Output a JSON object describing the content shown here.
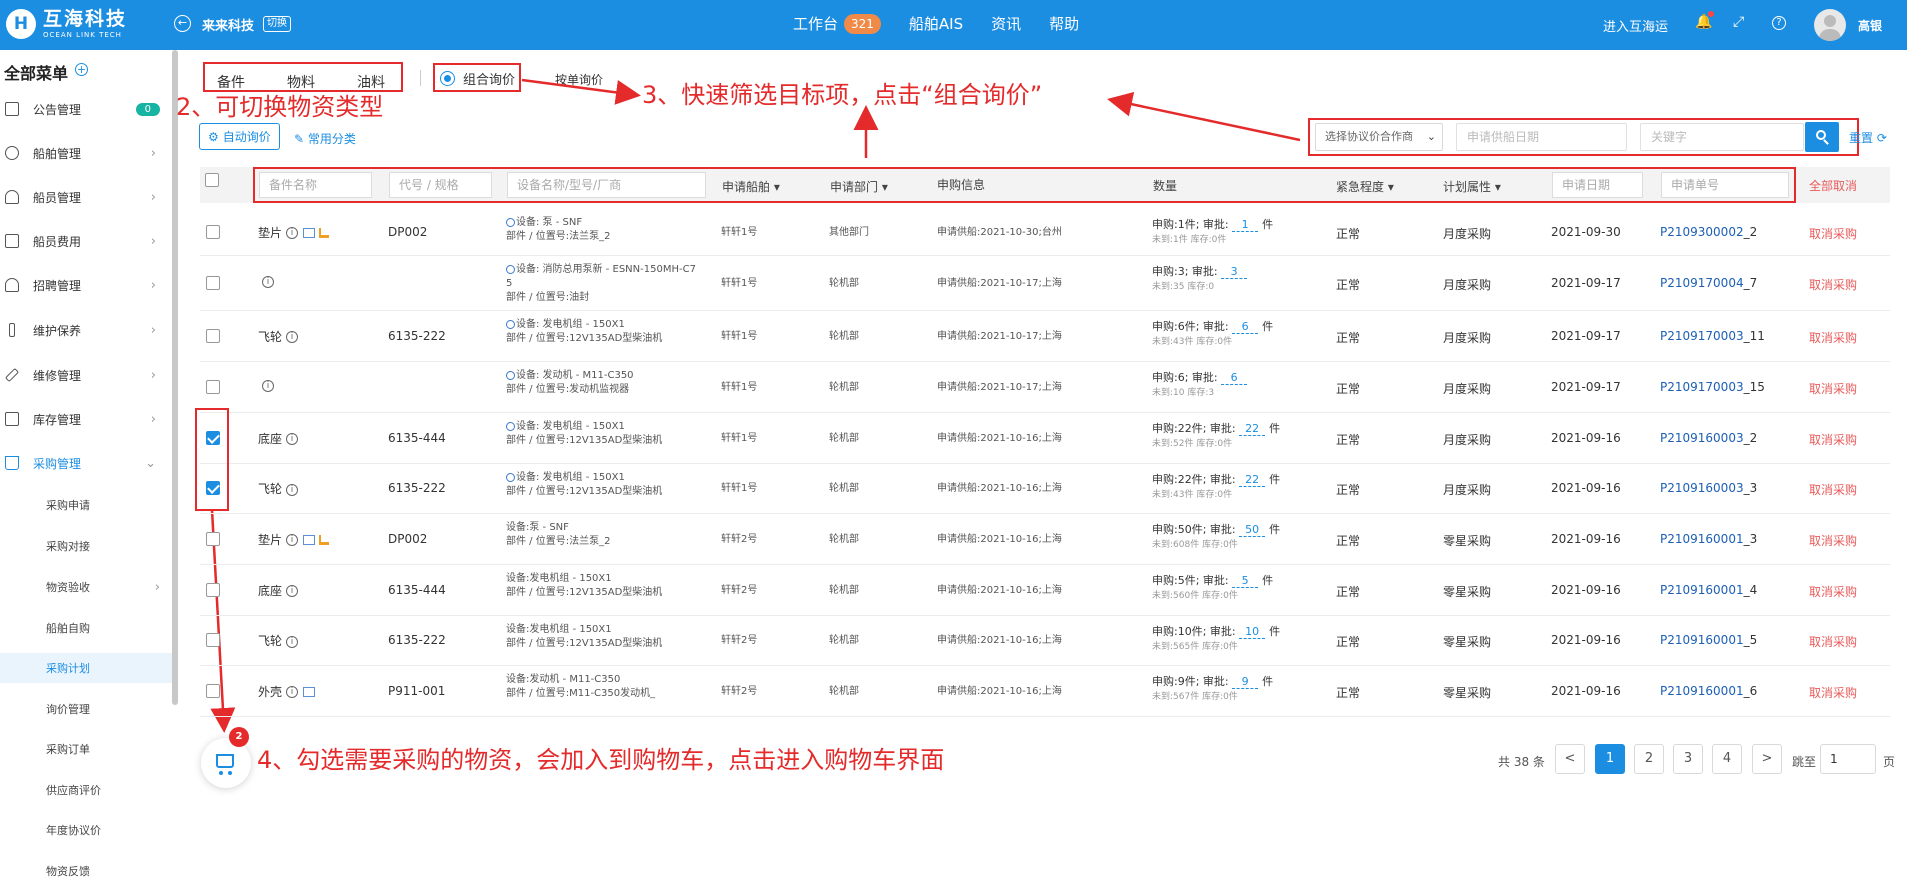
{
  "header": {
    "logo_mark": "H",
    "brand_name": "互海科技",
    "brand_en": "OCEAN LINK TECH",
    "company": "来来科技",
    "switch_label": "切换",
    "nav": [
      {
        "label": "工作台",
        "badge": "321"
      },
      {
        "label": "船舶AIS"
      },
      {
        "label": "资讯"
      },
      {
        "label": "帮助"
      }
    ],
    "enter_link": "进入互海运",
    "username": "高银"
  },
  "sidebar": {
    "title": "全部菜单",
    "items": [
      {
        "label": "公告管理",
        "badge": "0"
      },
      {
        "label": "船舶管理"
      },
      {
        "label": "船员管理"
      },
      {
        "label": "船员费用"
      },
      {
        "label": "招聘管理"
      },
      {
        "label": "维护保养"
      },
      {
        "label": "维修管理"
      },
      {
        "label": "库存管理"
      },
      {
        "label": "采购管理"
      }
    ],
    "sub_items": [
      "采购申请",
      "采购对接",
      "物资验收",
      "船舶自购",
      "采购计划",
      "询价管理",
      "采购订单",
      "供应商评价",
      "年度协议价",
      "物资反馈"
    ]
  },
  "toolbar": {
    "type_tabs": [
      "备件",
      "物料",
      "油料"
    ],
    "combo_inquiry": "组合询价",
    "by_order": "按单询价",
    "auto_inquiry": "自动询价",
    "common_category": "常用分类",
    "partner_select": "选择协议价合作商",
    "date_placeholder": "申请供船日期",
    "keyword_placeholder": "关键字",
    "reset": "重置"
  },
  "annotations": {
    "a2": "2、可切换物资类型",
    "a3": "3、快速筛选目标项，点击“组合询价”",
    "a4": "4、勾选需要采购的物资，会加入到购物车，点击进入购物车界面"
  },
  "table": {
    "filters": {
      "part_name": "备件名称",
      "code_spec": "代号 / 规格",
      "device": "设备名称/型号/厂商",
      "apply_date": "申请日期",
      "order_no": "申请单号"
    },
    "headers": {
      "ship": "申请船舶",
      "dept": "申请部门",
      "apply_info": "申购信息",
      "qty": "数量",
      "urgency": "紧急程度",
      "plan": "计划属性",
      "cancel_all": "全部取消"
    },
    "rows": [
      {
        "name": "垫片",
        "img": true,
        "stack": true,
        "code": "DP002",
        "dev1": "设备: 泵 - SNF",
        "dev2": "部件 / 位置号:法兰泵_2",
        "chain": true,
        "ship": "轩轩1号",
        "dept": "其他部门",
        "info": "申请供船:2021-10-30;台州",
        "qty1": "申购:1件; 审批:",
        "approve": "1",
        "unit": "件",
        "qty2": "未到:1件 库存:0件",
        "urgency": "正常",
        "plan": "月度采购",
        "date": "2021-09-30",
        "order": "P2109300002",
        "suffix": "_2",
        "cancel": "取消采购",
        "checked": false
      },
      {
        "name": "",
        "img": false,
        "stack": false,
        "code": "",
        "dev1": "设备: 消防总用泵新 - ESNN-150MH-C7",
        "dev1b": "5",
        "dev2": "部件 / 位置号:油封",
        "chain": true,
        "ship": "轩轩1号",
        "dept": "轮机部",
        "info": "申请供船:2021-10-17;上海",
        "qty1": "申购:3; 审批:",
        "approve": "3",
        "unit": "",
        "qty2": "未到:35 库存:0",
        "urgency": "正常",
        "plan": "月度采购",
        "date": "2021-09-17",
        "order": "P2109170004",
        "suffix": "_7",
        "cancel": "取消采购",
        "checked": false
      },
      {
        "name": "飞轮",
        "img": false,
        "stack": false,
        "code": "6135-222",
        "dev1": "设备: 发电机组 - 150X1",
        "dev2": "部件 / 位置号:12V135AD型柴油机",
        "chain": true,
        "ship": "轩轩1号",
        "dept": "轮机部",
        "info": "申请供船:2021-10-17;上海",
        "qty1": "申购:6件; 审批:",
        "approve": "6",
        "unit": "件",
        "qty2": "未到:43件 库存:0件",
        "urgency": "正常",
        "plan": "月度采购",
        "date": "2021-09-17",
        "order": "P2109170003",
        "suffix": "_11",
        "cancel": "取消采购",
        "checked": false
      },
      {
        "name": "",
        "img": false,
        "stack": false,
        "code": "",
        "dev1": "设备: 发动机 - M11-C350",
        "dev2": "部件 / 位置号:发动机监视器",
        "chain": true,
        "ship": "轩轩1号",
        "dept": "轮机部",
        "info": "申请供船:2021-10-17;上海",
        "qty1": "申购:6; 审批:",
        "approve": "6",
        "unit": "",
        "qty2": "未到:10 库存:3",
        "urgency": "正常",
        "plan": "月度采购",
        "date": "2021-09-17",
        "order": "P2109170003",
        "suffix": "_15",
        "cancel": "取消采购",
        "checked": false
      },
      {
        "name": "底座",
        "img": false,
        "stack": false,
        "code": "6135-444",
        "dev1": "设备: 发电机组 - 150X1",
        "dev2": "部件 / 位置号:12V135AD型柴油机",
        "chain": true,
        "ship": "轩轩1号",
        "dept": "轮机部",
        "info": "申请供船:2021-10-16;上海",
        "qty1": "申购:22件; 审批:",
        "approve": "22",
        "unit": "件",
        "qty2": "未到:52件 库存:0件",
        "urgency": "正常",
        "plan": "月度采购",
        "date": "2021-09-16",
        "order": "P2109160003",
        "suffix": "_2",
        "cancel": "取消采购",
        "checked": true
      },
      {
        "name": "飞轮",
        "img": false,
        "stack": false,
        "code": "6135-222",
        "dev1": "设备: 发电机组 - 150X1",
        "dev2": "部件 / 位置号:12V135AD型柴油机",
        "chain": true,
        "ship": "轩轩1号",
        "dept": "轮机部",
        "info": "申请供船:2021-10-16;上海",
        "qty1": "申购:22件; 审批:",
        "approve": "22",
        "unit": "件",
        "qty2": "未到:43件 库存:0件",
        "urgency": "正常",
        "plan": "月度采购",
        "date": "2021-09-16",
        "order": "P2109160003",
        "suffix": "_3",
        "cancel": "取消采购",
        "checked": true
      },
      {
        "name": "垫片",
        "img": true,
        "stack": true,
        "code": "DP002",
        "dev1": "设备:泵 - SNF",
        "dev2": "部件 / 位置号:法兰泵_2",
        "chain": false,
        "ship": "轩轩2号",
        "dept": "轮机部",
        "info": "申请供船:2021-10-16;上海",
        "qty1": "申购:50件; 审批:",
        "approve": "50",
        "unit": "件",
        "qty2": "未到:608件 库存:0件",
        "urgency": "正常",
        "plan": "零星采购",
        "date": "2021-09-16",
        "order": "P2109160001",
        "suffix": "_3",
        "cancel": "取消采购",
        "checked": false
      },
      {
        "name": "底座",
        "img": false,
        "stack": false,
        "code": "6135-444",
        "dev1": "设备:发电机组 - 150X1",
        "dev2": "部件 / 位置号:12V135AD型柴油机",
        "chain": false,
        "ship": "轩轩2号",
        "dept": "轮机部",
        "info": "申请供船:2021-10-16;上海",
        "qty1": "申购:5件; 审批:",
        "approve": "5",
        "unit": "件",
        "qty2": "未到:560件 库存:0件",
        "urgency": "正常",
        "plan": "零星采购",
        "date": "2021-09-16",
        "order": "P2109160001",
        "suffix": "_4",
        "cancel": "取消采购",
        "checked": false
      },
      {
        "name": "飞轮",
        "img": false,
        "stack": false,
        "code": "6135-222",
        "dev1": "设备:发电机组 - 150X1",
        "dev2": "部件 / 位置号:12V135AD型柴油机",
        "chain": false,
        "ship": "轩轩2号",
        "dept": "轮机部",
        "info": "申请供船:2021-10-16;上海",
        "qty1": "申购:10件; 审批:",
        "approve": "10",
        "unit": "件",
        "qty2": "未到:565件 库存:0件",
        "urgency": "正常",
        "plan": "零星采购",
        "date": "2021-09-16",
        "order": "P2109160001",
        "suffix": "_5",
        "cancel": "取消采购",
        "checked": false
      },
      {
        "name": "外壳",
        "img": true,
        "stack": false,
        "code": "P911-001",
        "dev1": "设备:发动机 - M11-C350",
        "dev2": "部件 / 位置号:M11-C350发动机_",
        "chain": false,
        "ship": "轩轩2号",
        "dept": "轮机部",
        "info": "申请供船:2021-10-16;上海",
        "qty1": "申购:9件; 审批:",
        "approve": "9",
        "unit": "件",
        "qty2": "未到:567件 库存:0件",
        "urgency": "正常",
        "plan": "零星采购",
        "date": "2021-09-16",
        "order": "P2109160001",
        "suffix": "_6",
        "cancel": "取消采购",
        "checked": false
      }
    ]
  },
  "cart": {
    "count": "2"
  },
  "pagination": {
    "total": "共 38 条",
    "prev": "<",
    "next": ">",
    "pages": [
      "1",
      "2",
      "3",
      "4"
    ],
    "current": "1",
    "goto_label": "跳至",
    "goto_value": "1",
    "page_unit": "页"
  }
}
